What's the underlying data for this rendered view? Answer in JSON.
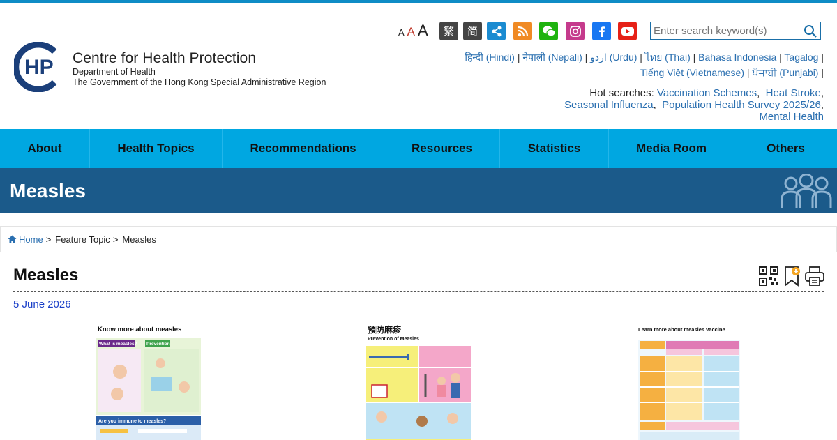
{
  "header": {
    "org_name": "Centre for Health Protection",
    "dept": "Department of Health",
    "gov": "The Government of the Hong Kong Special Administrative Region",
    "font_sizes": [
      "A",
      "A",
      "A"
    ],
    "trad": "繁",
    "simp": "简",
    "search_placeholder": "Enter search keyword(s)",
    "languages": [
      "हिन्दी (Hindi)",
      "नेपाली (Nepali)",
      "اردو (Urdu)",
      "ไทย (Thai)",
      "Bahasa Indonesia",
      "Tagalog",
      "Tiếng Việt (Vietnamese)",
      "ਪੰਜਾਬੀ (Punjabi)"
    ],
    "separator": "|",
    "hot_label": "Hot searches:",
    "hot_searches": [
      "Vaccination Schemes",
      "Heat Stroke",
      "Seasonal Influenza",
      "Population Health Survey 2025/26",
      "Mental Health"
    ]
  },
  "nav": [
    "About",
    "Health Topics",
    "Recommendations",
    "Resources",
    "Statistics",
    "Media Room",
    "Others"
  ],
  "banner": {
    "title": "Measles"
  },
  "breadcrumb": {
    "home": "Home",
    "sep": ">",
    "feature": "Feature Topic",
    "current": "Measles"
  },
  "page": {
    "title": "Measles",
    "date": "5 June 2026"
  },
  "posters": [
    {
      "title": "Know more about measles",
      "sub1": "What is measles?",
      "sub2": "Prevention",
      "sub3": "Are you immune to measles?"
    },
    {
      "title": "預防麻疹",
      "subtitle": "Prevention of Measles"
    },
    {
      "title": "Learn more about measles vaccine"
    }
  ],
  "colors": {
    "nav": "#00a7e1",
    "banner": "#1b5a8a",
    "link": "#2a6fb0",
    "date": "#1a3fc8"
  },
  "icons": [
    "share-icon",
    "rss-icon",
    "wechat-icon",
    "instagram-icon",
    "facebook-icon",
    "youtube-icon",
    "search-icon",
    "home-icon",
    "qr-code-icon",
    "bookmark-icon",
    "print-icon",
    "people-icon"
  ]
}
